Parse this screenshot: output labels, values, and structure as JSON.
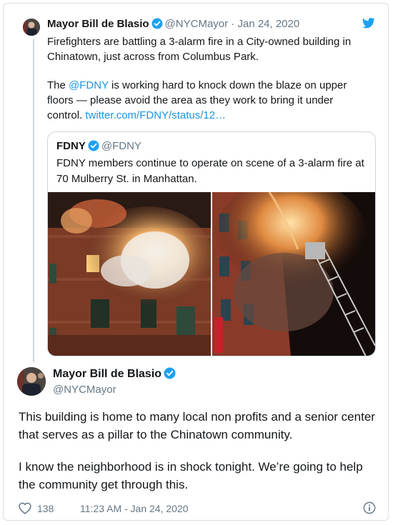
{
  "parent_tweet": {
    "name": "Mayor Bill de Blasio",
    "handle": "@NYCMayor",
    "separator": "·",
    "date": "Jan 24, 2020",
    "paragraph1": "Firefighters are battling a 3-alarm fire in a City-owned building in Chinatown, just across from Columbus Park.",
    "p2_prefix": "The ",
    "p2_mention": "@FDNY",
    "p2_middle": " is working hard to knock down the blaze on upper floors — please avoid the area as they work to bring it under control. ",
    "p2_link": "twitter.com/FDNY/status/12…"
  },
  "quoted_tweet": {
    "name": "FDNY",
    "handle": "@FDNY",
    "text": "FDNY members continue to operate on scene of a 3-alarm fire at 70 Mulberry St. in Manhattan."
  },
  "main_tweet": {
    "name": "Mayor Bill de Blasio",
    "handle": "@NYCMayor",
    "paragraph1": "This building is home to many local non profits and a senior center that serves as a pillar to the Chinatown community.",
    "paragraph2": "I know the neighborhood is in shock tonight. We’re going to help the community get through this.",
    "likes": "138",
    "timestamp": "11:23 AM - Jan 24, 2020"
  },
  "icons": [
    "twitter-bird-icon",
    "verified-badge-icon",
    "heart-icon",
    "info-icon"
  ],
  "colors": {
    "link": "#1b95e0",
    "verified": "#1da1f2",
    "muted": "#657786",
    "text": "#14171a"
  }
}
